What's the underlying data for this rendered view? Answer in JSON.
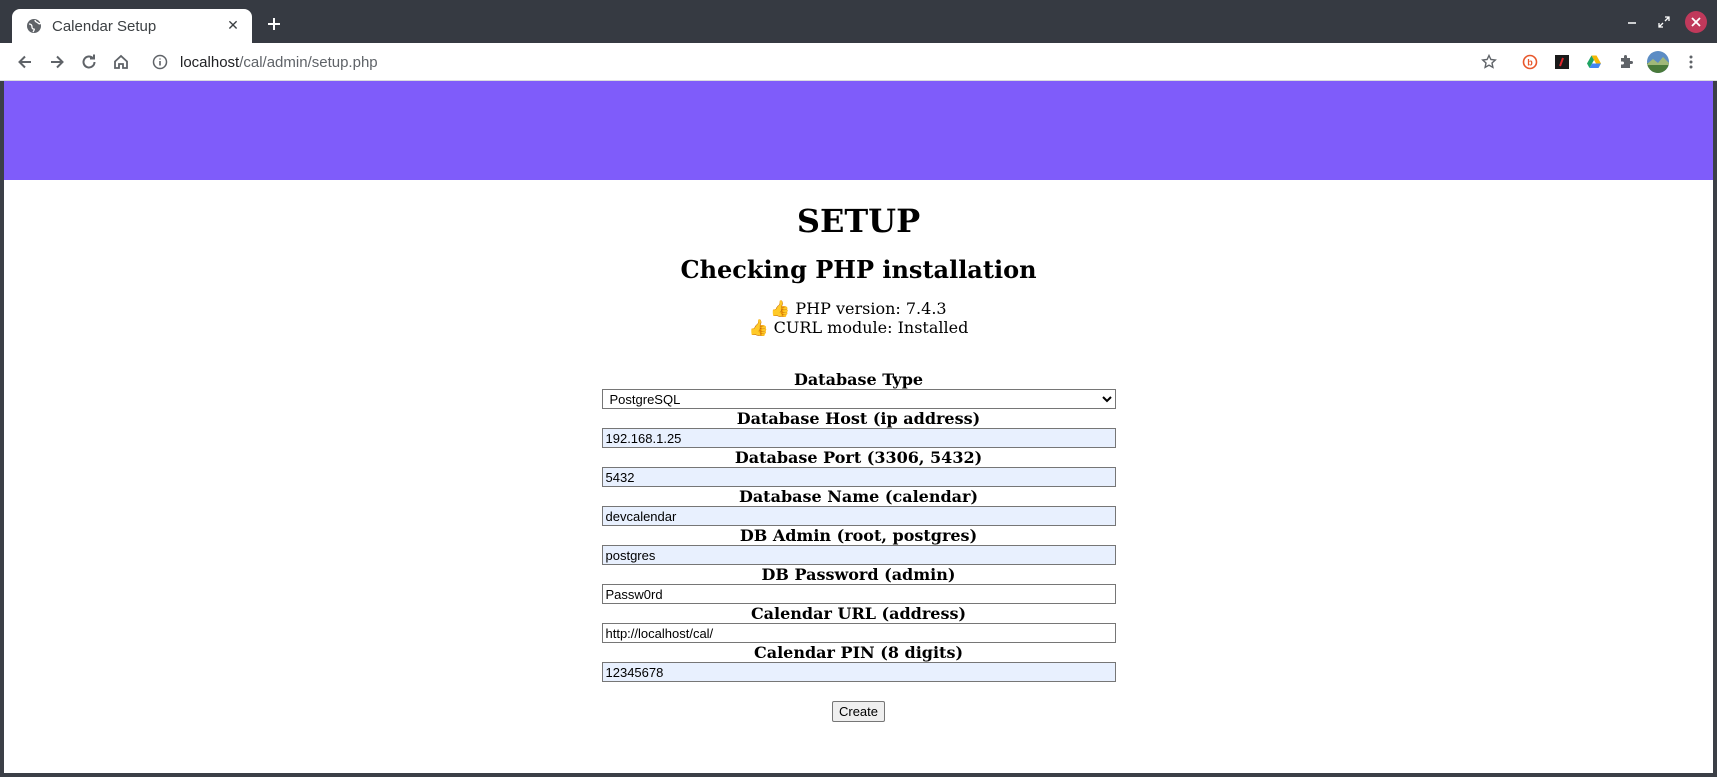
{
  "browser": {
    "tab_title": "Calendar Setup",
    "url_host": "localhost",
    "url_path": "/cal/admin/setup.php",
    "icons": [
      "globe-icon",
      "close-icon",
      "plus-icon",
      "back-icon",
      "forward-icon",
      "reload-icon",
      "home-icon",
      "info-icon",
      "star-icon",
      "extension-icon",
      "avatar"
    ]
  },
  "page": {
    "banner_color": "#7f5cfa",
    "heading": "SETUP",
    "subheading": "Checking PHP installation",
    "checks": [
      {
        "text": "PHP version: 7.4.3"
      },
      {
        "text": "CURL module: Installed"
      }
    ]
  },
  "form": {
    "db_type_label": "Database Type",
    "db_type_value": "PostgreSQL",
    "db_host_label": "Database Host (ip address)",
    "db_host_value": "192.168.1.25",
    "db_port_label": "Database Port (3306, 5432)",
    "db_port_value": "5432",
    "db_name_label": "Database Name (calendar)",
    "db_name_value": "devcalendar",
    "db_admin_label": "DB Admin (root, postgres)",
    "db_admin_value": "postgres",
    "db_password_label": "DB Password (admin)",
    "db_password_value": "Passw0rd",
    "cal_url_label": "Calendar URL (address)",
    "cal_url_value": "http://localhost/cal/",
    "cal_pin_label": "Calendar PIN (8 digits)",
    "cal_pin_value": "12345678",
    "submit_label": "Create"
  }
}
